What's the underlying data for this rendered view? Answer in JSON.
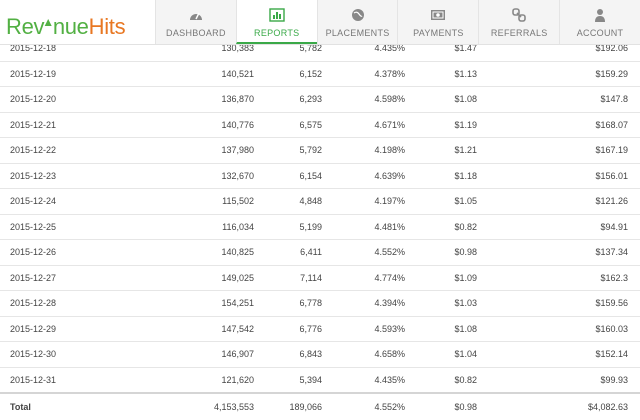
{
  "logo": {
    "part1": "Rev",
    "part2": "nue",
    "part3": "Hits"
  },
  "nav": [
    {
      "label": "DASHBOARD",
      "icon": "dashboard-gauge-icon",
      "active": false
    },
    {
      "label": "REPORTS",
      "icon": "bar-chart-icon",
      "active": true
    },
    {
      "label": "PLACEMENTS",
      "icon": "globe-icon",
      "active": false
    },
    {
      "label": "PAYMENTS",
      "icon": "banknote-icon",
      "active": false
    },
    {
      "label": "REFERRALS",
      "icon": "link-icon",
      "active": false
    },
    {
      "label": "ACCOUNT",
      "icon": "user-icon",
      "active": false
    }
  ],
  "colors": {
    "accent": "#3aa948",
    "logo_green": "#52b043",
    "logo_orange": "#e87722"
  },
  "rows": [
    {
      "date": "2015-12-18",
      "impressions": "130,383",
      "clicks": "5,782",
      "rate": "4.435%",
      "ecpm": "$1.47",
      "revenue": "$192.06"
    },
    {
      "date": "2015-12-19",
      "impressions": "140,521",
      "clicks": "6,152",
      "rate": "4.378%",
      "ecpm": "$1.13",
      "revenue": "$159.29"
    },
    {
      "date": "2015-12-20",
      "impressions": "136,870",
      "clicks": "6,293",
      "rate": "4.598%",
      "ecpm": "$1.08",
      "revenue": "$147.8"
    },
    {
      "date": "2015-12-21",
      "impressions": "140,776",
      "clicks": "6,575",
      "rate": "4.671%",
      "ecpm": "$1.19",
      "revenue": "$168.07"
    },
    {
      "date": "2015-12-22",
      "impressions": "137,980",
      "clicks": "5,792",
      "rate": "4.198%",
      "ecpm": "$1.21",
      "revenue": "$167.19"
    },
    {
      "date": "2015-12-23",
      "impressions": "132,670",
      "clicks": "6,154",
      "rate": "4.639%",
      "ecpm": "$1.18",
      "revenue": "$156.01"
    },
    {
      "date": "2015-12-24",
      "impressions": "115,502",
      "clicks": "4,848",
      "rate": "4.197%",
      "ecpm": "$1.05",
      "revenue": "$121.26"
    },
    {
      "date": "2015-12-25",
      "impressions": "116,034",
      "clicks": "5,199",
      "rate": "4.481%",
      "ecpm": "$0.82",
      "revenue": "$94.91"
    },
    {
      "date": "2015-12-26",
      "impressions": "140,825",
      "clicks": "6,411",
      "rate": "4.552%",
      "ecpm": "$0.98",
      "revenue": "$137.34"
    },
    {
      "date": "2015-12-27",
      "impressions": "149,025",
      "clicks": "7,114",
      "rate": "4.774%",
      "ecpm": "$1.09",
      "revenue": "$162.3"
    },
    {
      "date": "2015-12-28",
      "impressions": "154,251",
      "clicks": "6,778",
      "rate": "4.394%",
      "ecpm": "$1.03",
      "revenue": "$159.56"
    },
    {
      "date": "2015-12-29",
      "impressions": "147,542",
      "clicks": "6,776",
      "rate": "4.593%",
      "ecpm": "$1.08",
      "revenue": "$160.03"
    },
    {
      "date": "2015-12-30",
      "impressions": "146,907",
      "clicks": "6,843",
      "rate": "4.658%",
      "ecpm": "$1.04",
      "revenue": "$152.14"
    },
    {
      "date": "2015-12-31",
      "impressions": "121,620",
      "clicks": "5,394",
      "rate": "4.435%",
      "ecpm": "$0.82",
      "revenue": "$99.93"
    }
  ],
  "total": {
    "label": "Total",
    "impressions": "4,153,553",
    "clicks": "189,066",
    "rate": "4.552%",
    "ecpm": "$0.98",
    "revenue": "$4,082.63"
  }
}
